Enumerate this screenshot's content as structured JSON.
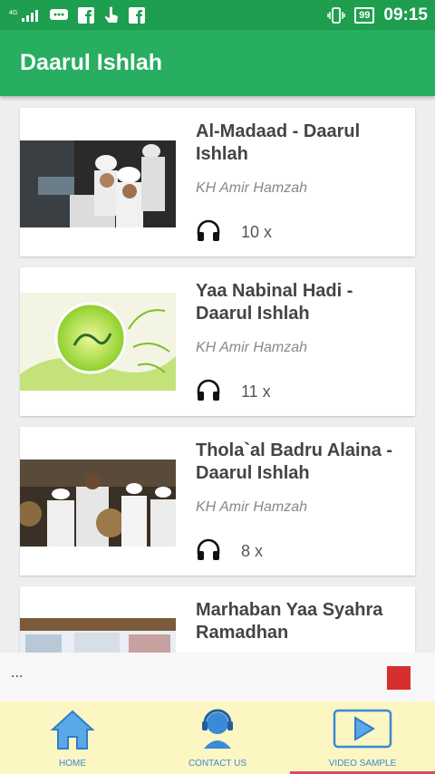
{
  "status_bar": {
    "network": "4G",
    "battery": "99",
    "time": "09:15",
    "icons": [
      "signal-icon",
      "chat-icon",
      "facebook-icon",
      "touch-icon",
      "facebook-icon",
      "vibrate-icon",
      "battery-icon"
    ]
  },
  "app_bar": {
    "title": "Daarul Ishlah"
  },
  "tracks": [
    {
      "title": "Al-Madaad - Daarul Ishlah",
      "artist": "KH Amir Hamzah",
      "plays": "10 x"
    },
    {
      "title": "Yaa Nabinal Hadi - Daarul Ishlah",
      "artist": "KH Amir Hamzah",
      "plays": "11 x"
    },
    {
      "title": "Thola`al Badru Alaina - Daarul Ishlah",
      "artist": "KH Amir Hamzah",
      "plays": "8 x"
    },
    {
      "title": "Marhaban Yaa Syahra Ramadhan",
      "artist": "",
      "plays": ""
    }
  ],
  "ad_bar": {
    "text": "..."
  },
  "bottom_nav": [
    {
      "label": "HOME",
      "icon": "home-icon"
    },
    {
      "label": "CONTACT US",
      "icon": "support-icon"
    },
    {
      "label": "VIDEO SAMPLE",
      "icon": "play-icon"
    }
  ],
  "colors": {
    "primary": "#27ae60",
    "status_bar": "#1e9e4f",
    "nav_bg": "#fbf6c2",
    "nav_accent": "#3a8ad6"
  }
}
